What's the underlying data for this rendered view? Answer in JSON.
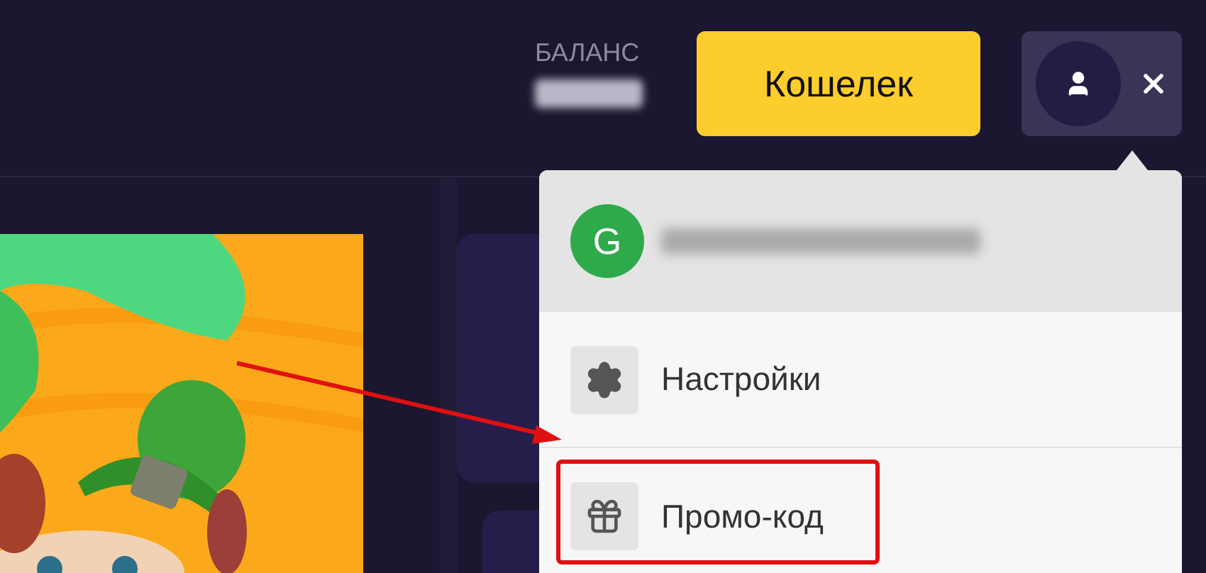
{
  "header": {
    "balance_label": "БАЛАНС",
    "wallet_button": "Кошелек",
    "user_menu_open": true
  },
  "account_menu": {
    "avatar_letter": "G",
    "items": [
      {
        "label": "Настройки",
        "kind": "settings",
        "annotated": false
      },
      {
        "label": "Промо-код",
        "kind": "promo",
        "annotated": true
      }
    ]
  }
}
